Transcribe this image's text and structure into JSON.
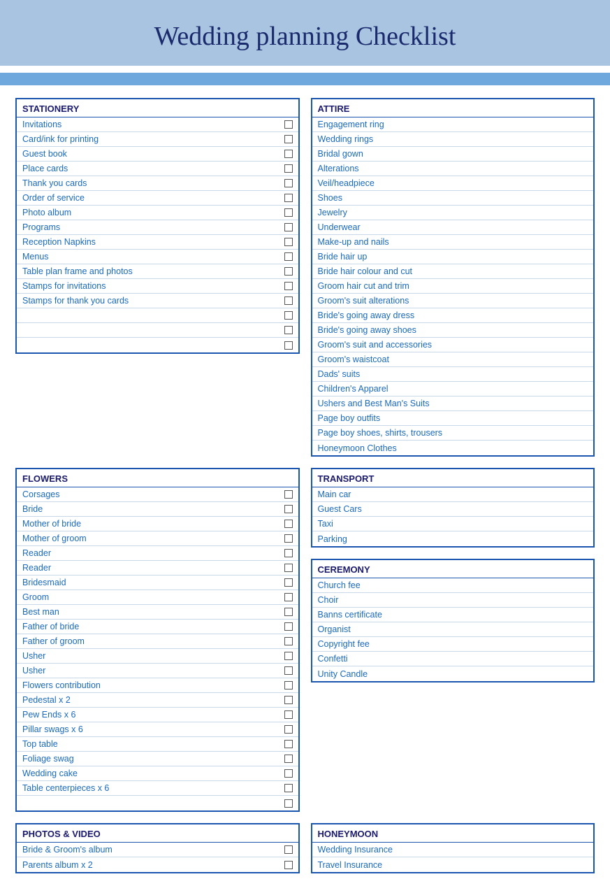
{
  "header": {
    "title": "Wedding planning Checklist"
  },
  "sections": {
    "stationery": {
      "title": "STATIONERY",
      "items": [
        "Invitations",
        "Card/ink for printing",
        "Guest book",
        "Place cards",
        "Thank you cards",
        "Order of service",
        "Photo album",
        "Programs",
        "Reception Napkins",
        "Menus",
        "Table plan frame and photos",
        "Stamps for invitations",
        "Stamps for thank you cards",
        "",
        "",
        ""
      ]
    },
    "attire": {
      "title": "ATTIRE",
      "items_no_check": [
        "Engagement ring",
        "Wedding rings",
        "Bridal gown",
        "Alterations",
        "Veil/headpiece",
        "Shoes",
        "Jewelry",
        "Underwear",
        "Make-up and nails",
        "Bride hair up",
        "Bride hair colour and cut",
        "Groom hair cut and trim",
        "Groom's suit alterations",
        "Bride's going away dress",
        "Bride's going away shoes",
        "Groom's suit and accessories",
        "Groom's waistcoat",
        "Dads' suits",
        "Children's Apparel",
        "Ushers and Best Man's Suits",
        "Page boy outfits",
        "Page boy shoes, shirts, trousers",
        "Honeymoon Clothes"
      ]
    },
    "flowers": {
      "title": "FLOWERS",
      "items": [
        "Corsages",
        "Bride",
        "Mother of bride",
        "Mother of groom",
        "Reader",
        "Reader",
        "Bridesmaid",
        "Groom",
        "Best man",
        "Father of bride",
        "Father of groom",
        "Usher",
        "Usher",
        "Flowers contribution",
        "Pedestal x 2",
        "Pew Ends x 6",
        "Pillar swags x 6",
        "Top table",
        "Foliage swag",
        "Wedding cake",
        "Table centerpieces x 6",
        ""
      ]
    },
    "transport": {
      "title": "TRANSPORT",
      "items_no_check": [
        "Main car",
        "Guest Cars",
        "Taxi",
        "Parking"
      ]
    },
    "ceremony": {
      "title": "CEREMONY",
      "items_no_check": [
        "Church fee",
        "Choir",
        "Banns certificate",
        "Organist",
        "Copyright fee",
        "Confetti",
        "Unity Candle"
      ]
    },
    "photos_video": {
      "title": "PHOTOS & VIDEO",
      "items": [
        "Bride & Groom's album",
        "Parents album x 2"
      ]
    },
    "honeymoon": {
      "title": "HONEYMOON",
      "items_no_check": [
        "Wedding Insurance",
        "Travel Insurance"
      ]
    }
  }
}
